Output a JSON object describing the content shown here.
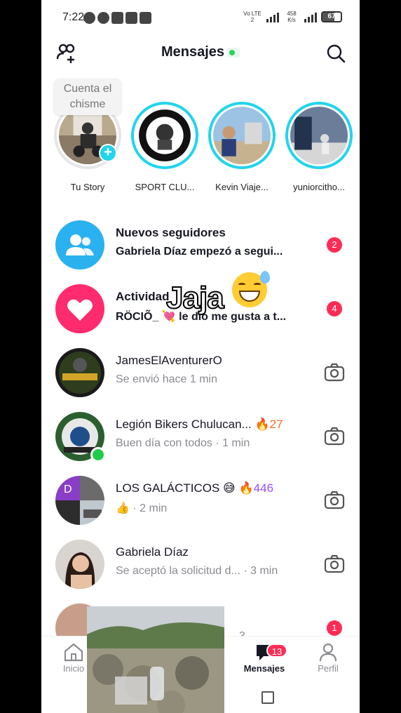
{
  "status_bar": {
    "time": "7:22",
    "lte_label": "Vo LTE 2",
    "speed": "458 K/s",
    "battery": "67"
  },
  "header": {
    "title": "Mensajes"
  },
  "tooltip": {
    "text": "Cuenta el chisme"
  },
  "stories": [
    {
      "label": "Tu Story"
    },
    {
      "label": "SPORT CLU..."
    },
    {
      "label": "Kevin Viaje..."
    },
    {
      "label": "yuniorcitho..."
    }
  ],
  "messages": [
    {
      "name": "Nuevos seguidores",
      "subtitle": "Gabriela Díaz empezó a segui...",
      "badge": "2"
    },
    {
      "name": "Actividad",
      "subtitle": "RÖCIÕ_ 💘 le dio me gusta a t...",
      "badge": "4"
    },
    {
      "name": "JamesElAventurerO",
      "subtitle": "Se envió hace 1 min"
    },
    {
      "name": "Legión Bikers Chulucan...",
      "streak": "27",
      "subtitle": "Buen día con todos · 1 min"
    },
    {
      "name": "LOS GALÁCTICOS 😅",
      "streak": "446",
      "subtitle": "👍 · 2 min"
    },
    {
      "name": "Gabriela Díaz",
      "subtitle": "Se aceptó la solicitud d...  · 3 min"
    },
    {
      "badge": "1",
      "subtitle": "3"
    }
  ],
  "overlay": {
    "text": "Jaja"
  },
  "nav": {
    "home": "Inicio",
    "messages": "Mensajes",
    "messages_badge": "13",
    "profile": "Perfil"
  },
  "colors": {
    "accent_cyan": "#20d5ec",
    "badge_red": "#fe2c55",
    "followers_blue": "#2ab1f0",
    "activity_pink": "#fe2c6f"
  }
}
